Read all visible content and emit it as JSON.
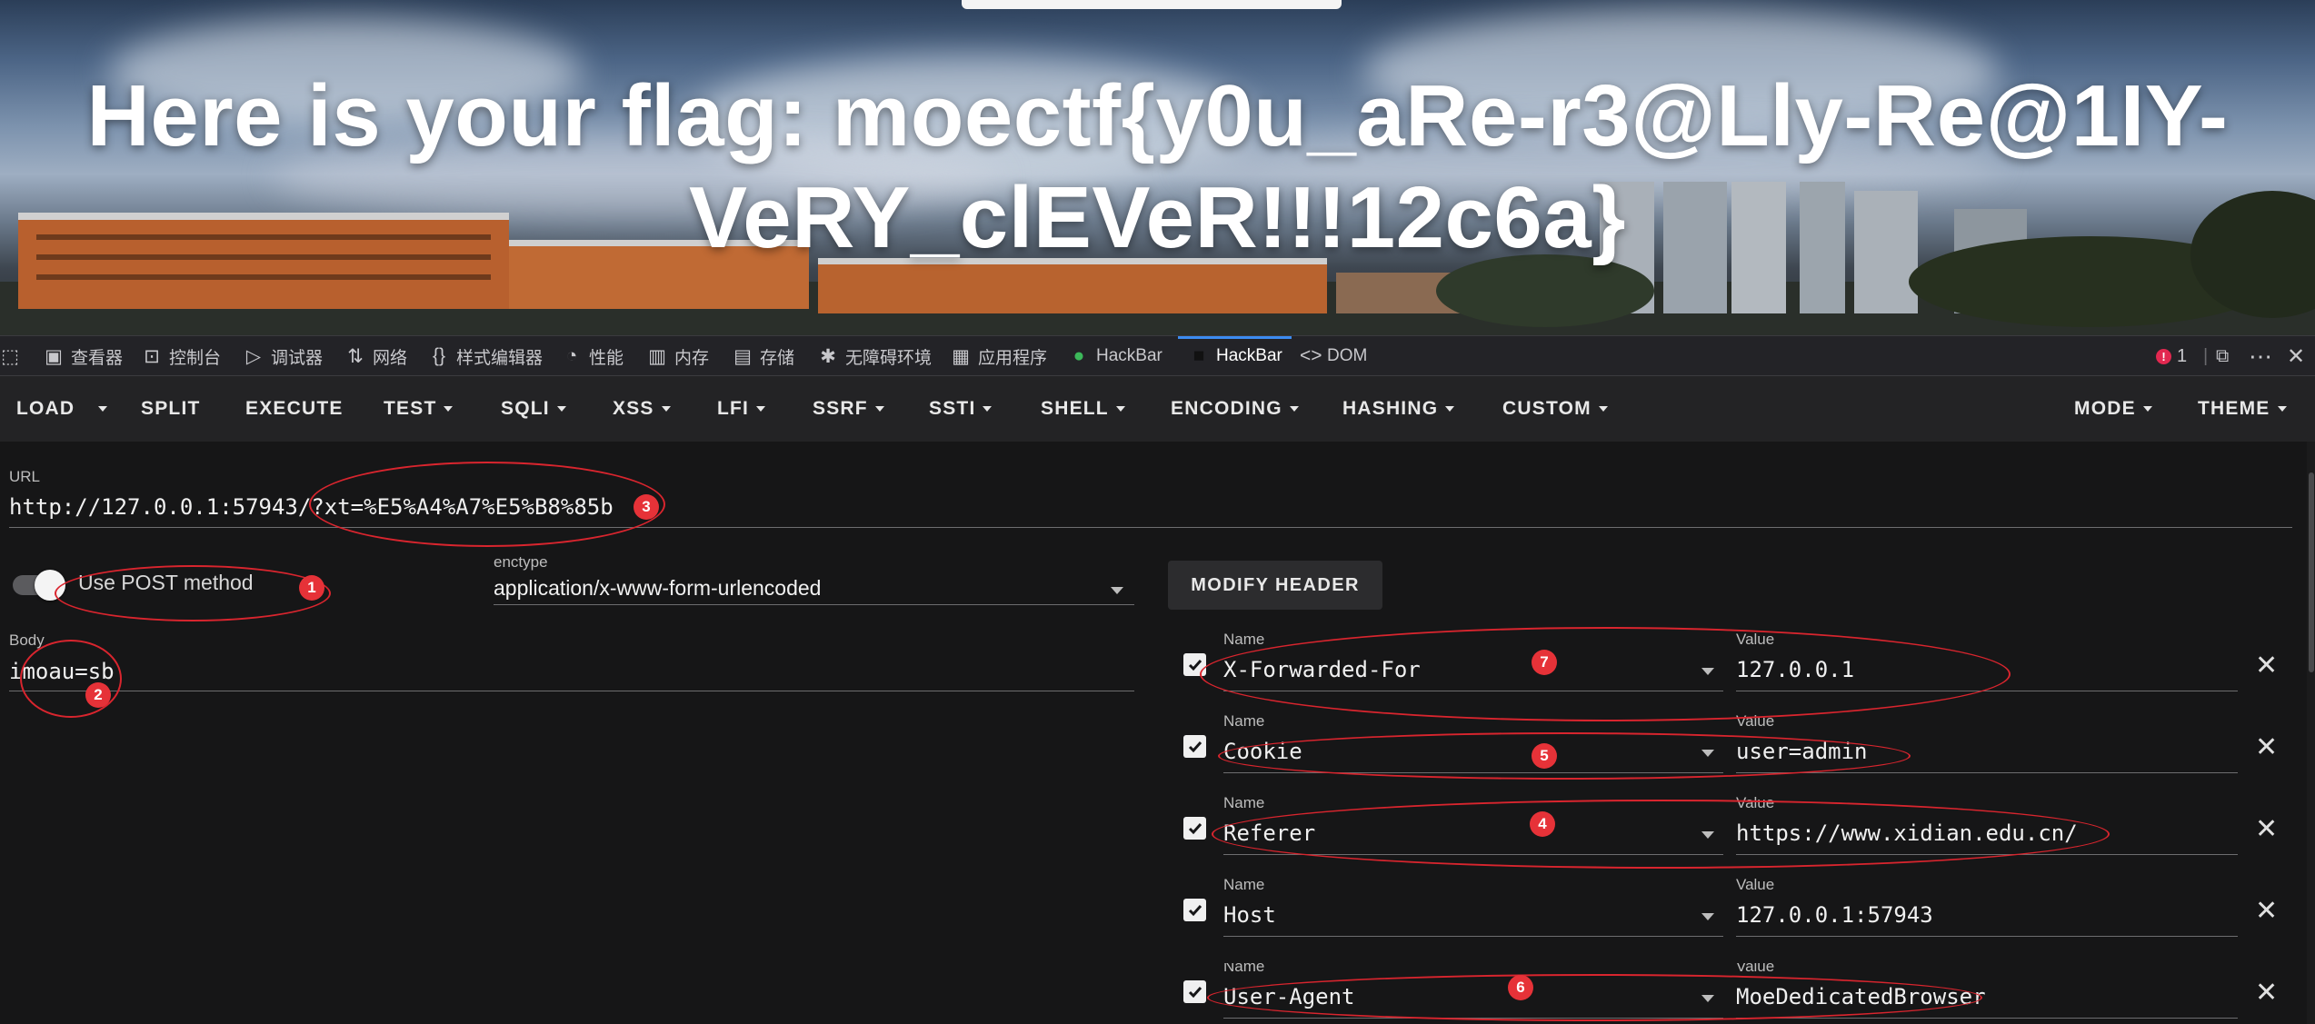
{
  "page": {
    "flag_line1": "Here is your flag: moectf{y0u_aRe-r3@Lly-Re@1IY-",
    "flag_line2": "VeRY_clEVeR!!!12c6a}"
  },
  "devtools": {
    "tabs": [
      {
        "icon": "inspector-icon",
        "label": "查看器"
      },
      {
        "icon": "console-icon",
        "label": "控制台"
      },
      {
        "icon": "debugger-icon",
        "label": "调试器"
      },
      {
        "icon": "network-icon",
        "label": "网络"
      },
      {
        "icon": "style-editor-icon",
        "label": "样式编辑器"
      },
      {
        "icon": "performance-icon",
        "label": "性能"
      },
      {
        "icon": "memory-icon",
        "label": "内存"
      },
      {
        "icon": "storage-icon",
        "label": "存储"
      },
      {
        "icon": "accessibility-icon",
        "label": "无障碍环境"
      },
      {
        "icon": "application-icon",
        "label": "应用程序"
      },
      {
        "icon": "hackbar-green-icon",
        "label": "HackBar"
      },
      {
        "icon": "hackbar-icon",
        "label": "HackBar"
      },
      {
        "icon": "dom-icon",
        "label": "DOM"
      }
    ],
    "error_count": "1"
  },
  "menu": {
    "load": "LOAD",
    "split": "SPLIT",
    "execute": "EXECUTE",
    "test": "TEST",
    "sqli": "SQLI",
    "xss": "XSS",
    "lfi": "LFI",
    "ssrf": "SSRF",
    "ssti": "SSTI",
    "shell": "SHELL",
    "encoding": "ENCODING",
    "hashing": "HASHING",
    "custom": "CUSTOM",
    "mode": "MODE",
    "theme": "THEME"
  },
  "url": {
    "label": "URL",
    "value": "http://127.0.0.1:57943/?xt=%E5%A4%A7%E5%B8%85b"
  },
  "post": {
    "toggle_label": "Use POST method",
    "enabled": true,
    "enctype_label": "enctype",
    "enctype_value": "application/x-www-form-urlencoded",
    "body_label": "Body",
    "body_value": "imoau=sb"
  },
  "headers": {
    "modify_button": "MODIFY HEADER",
    "name_label": "Name",
    "value_label": "Value",
    "rows": [
      {
        "name": "X-Forwarded-For",
        "value": "127.0.0.1",
        "checked": true
      },
      {
        "name": "Cookie",
        "value": "user=admin",
        "checked": true
      },
      {
        "name": "Referer",
        "value": "https://www.xidian.edu.cn/",
        "checked": true
      },
      {
        "name": "Host",
        "value": "127.0.0.1:57943",
        "checked": true
      },
      {
        "name": "User-Agent",
        "value": "MoeDedicatedBrowser",
        "checked": true
      }
    ]
  },
  "annotations": [
    "1",
    "2",
    "3",
    "4",
    "5",
    "6",
    "7"
  ],
  "colors": {
    "panel_bg": "#161617",
    "menubar_bg": "#232325",
    "annotation_red": "#d9252e",
    "active_tab_accent": "#3c8cf0"
  }
}
